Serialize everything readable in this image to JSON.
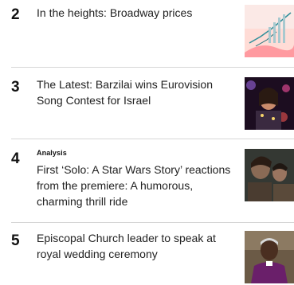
{
  "items": [
    {
      "rank": "2",
      "headline": "In the heights: Broadway prices",
      "thumb_icon": "broadway-prices-chart-image"
    },
    {
      "rank": "3",
      "headline": "The Latest: Barzilai wins Eurovision Song Contest for Israel",
      "thumb_icon": "eurovision-performer-image"
    },
    {
      "rank": "4",
      "label": "Analysis",
      "headline": "First ‘Solo: A Star Wars Story’ reactions from the premiere: A humorous, charming thrill ride",
      "thumb_icon": "solo-movie-still-image"
    },
    {
      "rank": "5",
      "headline": "Episcopal Church leader to speak at royal wedding ceremony",
      "thumb_icon": "church-leader-portrait-image"
    }
  ]
}
